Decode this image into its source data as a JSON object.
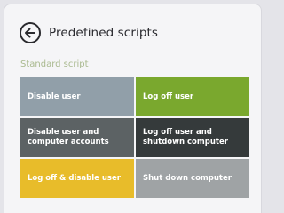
{
  "header": {
    "title": "Predefined scripts",
    "back_icon": "arrow-left-circle-icon"
  },
  "section": {
    "label": "Standard script"
  },
  "tiles": [
    {
      "label": "Disable user",
      "color": "#919fa9"
    },
    {
      "label": "Log off user",
      "color": "#7aa82e"
    },
    {
      "label": "Disable user and computer accounts",
      "color": "#5c6264"
    },
    {
      "label": "Log off user and shutdown computer",
      "color": "#353a3b"
    },
    {
      "label": "Log off & disable user",
      "color": "#e8bc2a"
    },
    {
      "label": "Shut down computer",
      "color": "#9fa3a5"
    }
  ],
  "colors": {
    "background": "#e4e4e9",
    "panel": "#f5f5f7",
    "section_label": "#a9b98f"
  }
}
